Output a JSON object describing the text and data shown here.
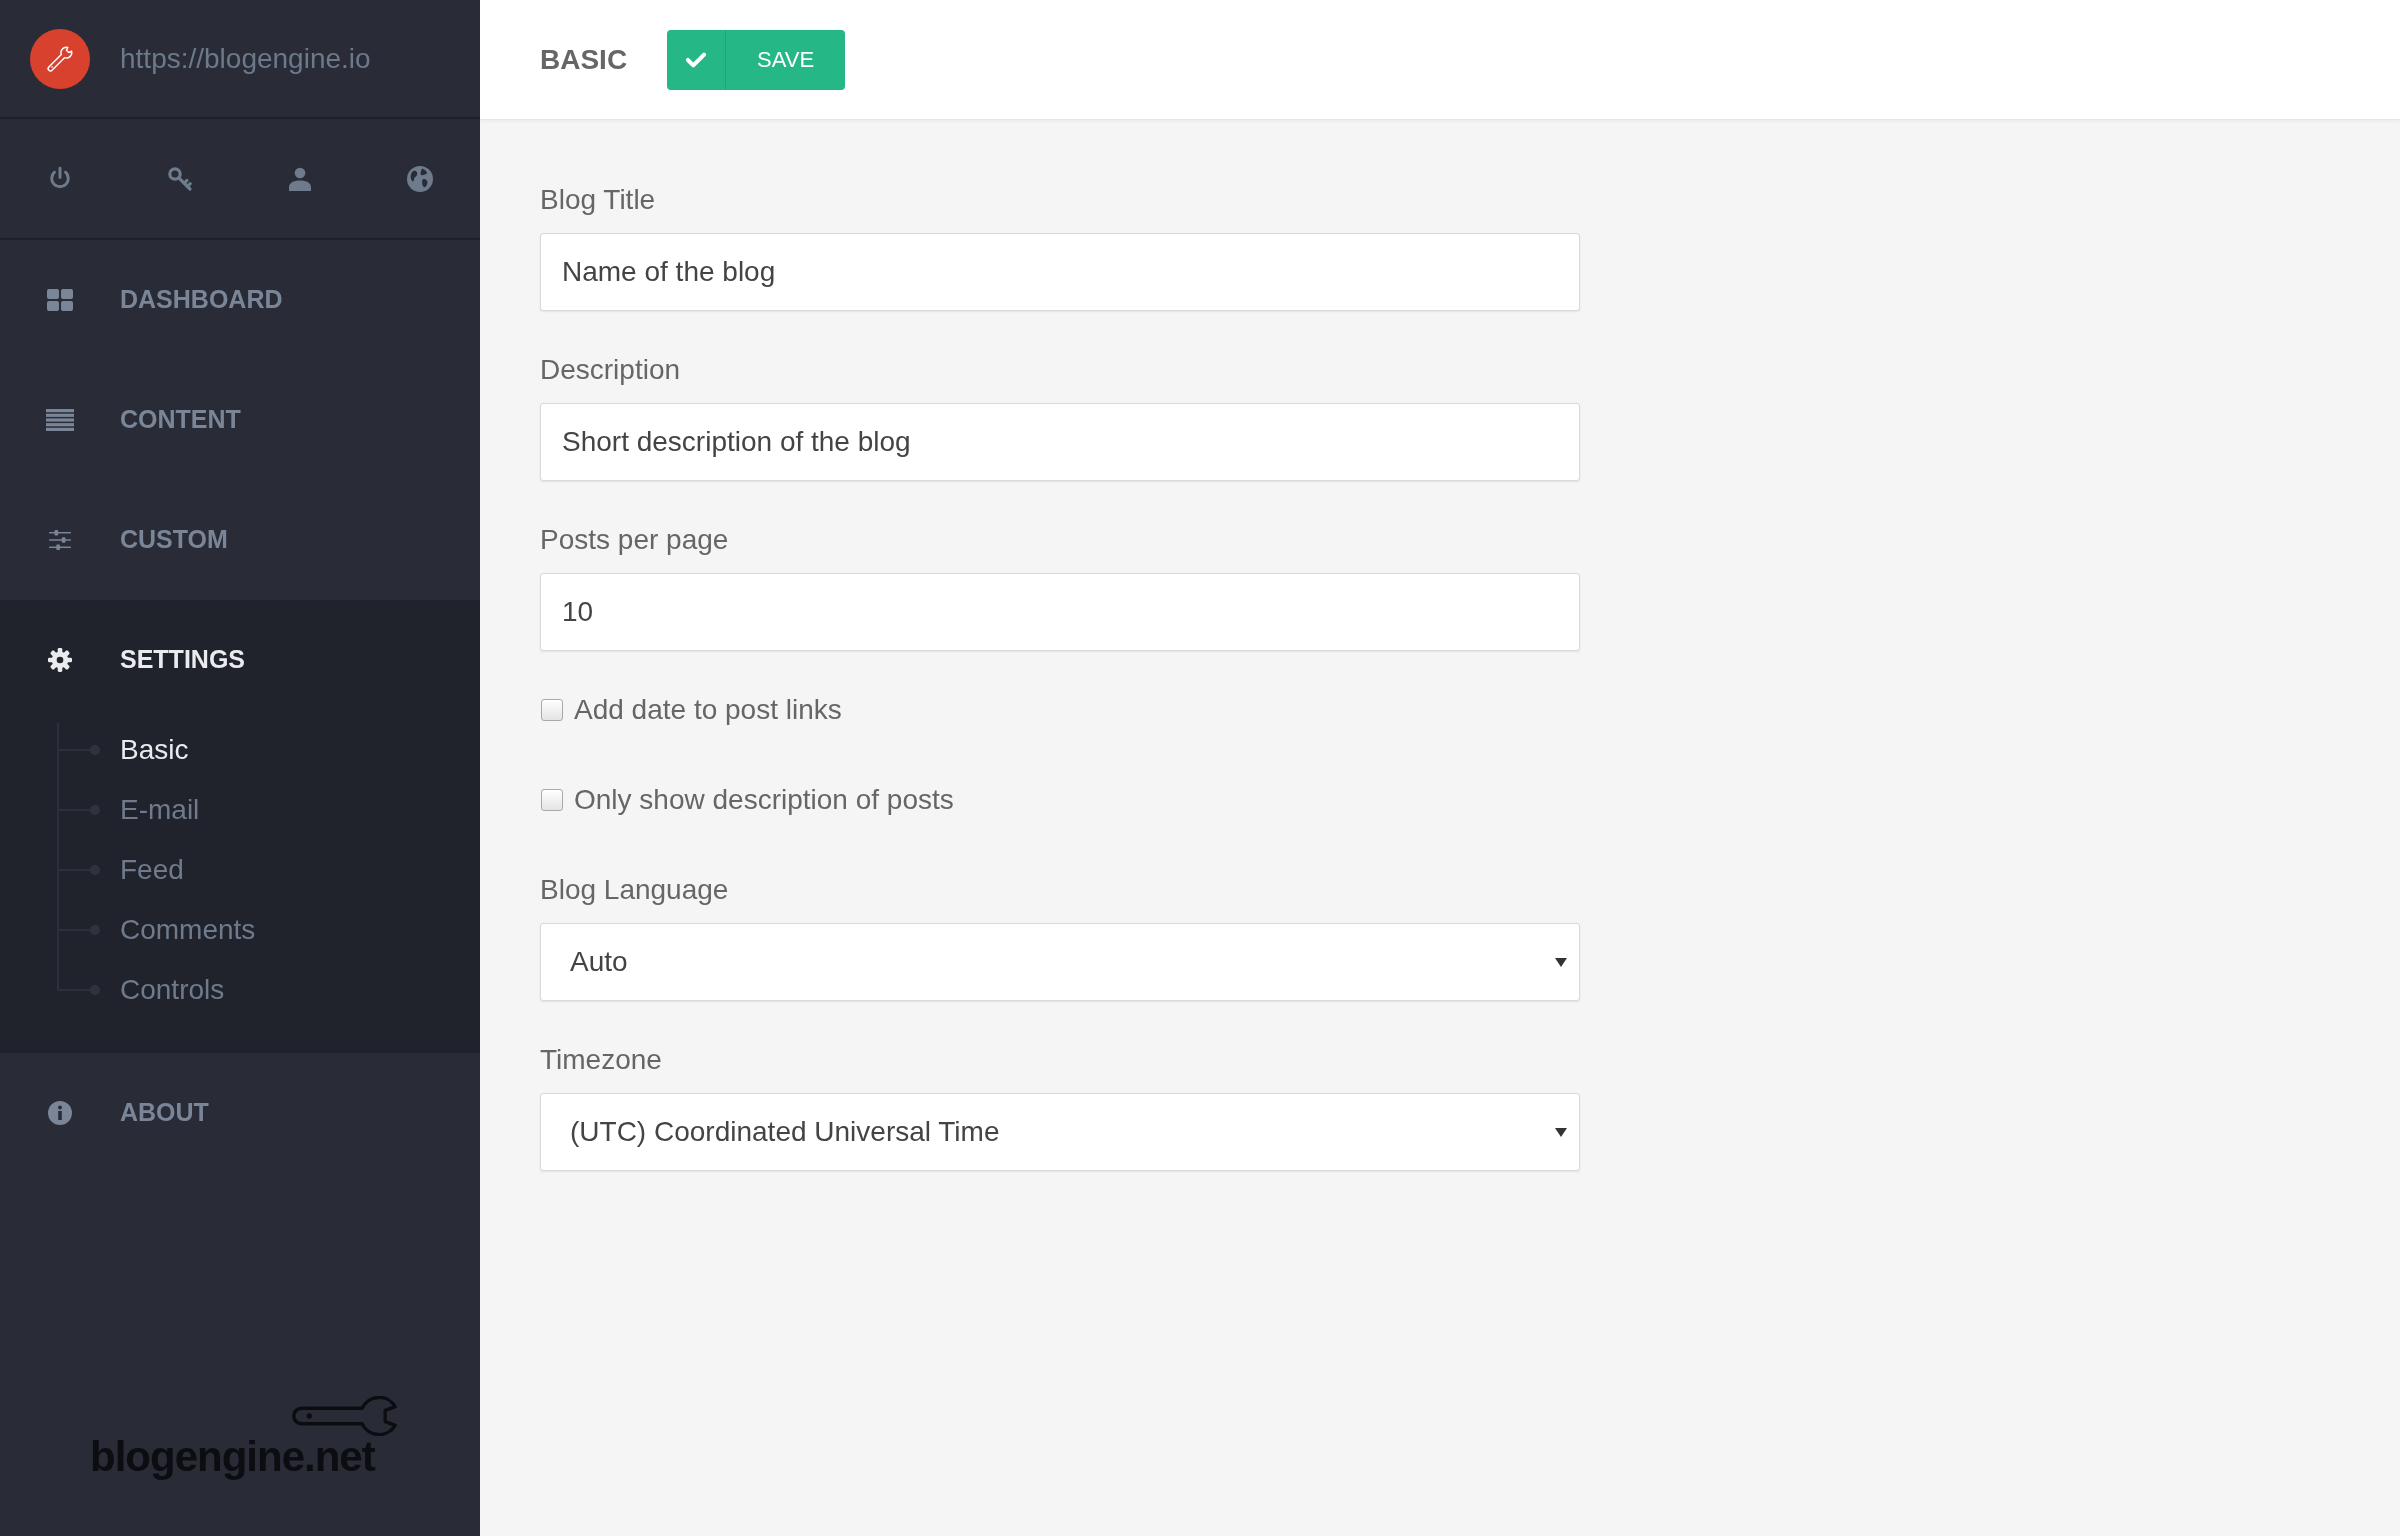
{
  "sidebar": {
    "site_url": "https://blogengine.io",
    "nav": [
      {
        "label": "DASHBOARD",
        "selected": false
      },
      {
        "label": "CONTENT",
        "selected": false
      },
      {
        "label": "CUSTOM",
        "selected": false
      },
      {
        "label": "SETTINGS",
        "selected": true,
        "children": [
          {
            "label": "Basic",
            "selected": true
          },
          {
            "label": "E-mail",
            "selected": false
          },
          {
            "label": "Feed",
            "selected": false
          },
          {
            "label": "Comments",
            "selected": false
          },
          {
            "label": "Controls",
            "selected": false
          }
        ]
      },
      {
        "label": "ABOUT",
        "selected": false
      }
    ],
    "footer_logo": "blogengine.net"
  },
  "header": {
    "title": "BASIC",
    "save_button": "SAVE"
  },
  "form": {
    "fields": [
      {
        "kind": "text",
        "label": "Blog Title",
        "value": "Name of the blog"
      },
      {
        "kind": "text",
        "label": "Description",
        "value": "Short description of the blog"
      },
      {
        "kind": "text",
        "label": "Posts per page",
        "value": "10"
      },
      {
        "kind": "checkbox",
        "label": "Add date to post links",
        "checked": false
      },
      {
        "kind": "checkbox",
        "label": "Only show description of posts",
        "checked": false
      },
      {
        "kind": "select",
        "label": "Blog Language",
        "value": "Auto"
      },
      {
        "kind": "select",
        "label": "Timezone",
        "value": "(UTC) Coordinated Universal Time"
      }
    ]
  }
}
